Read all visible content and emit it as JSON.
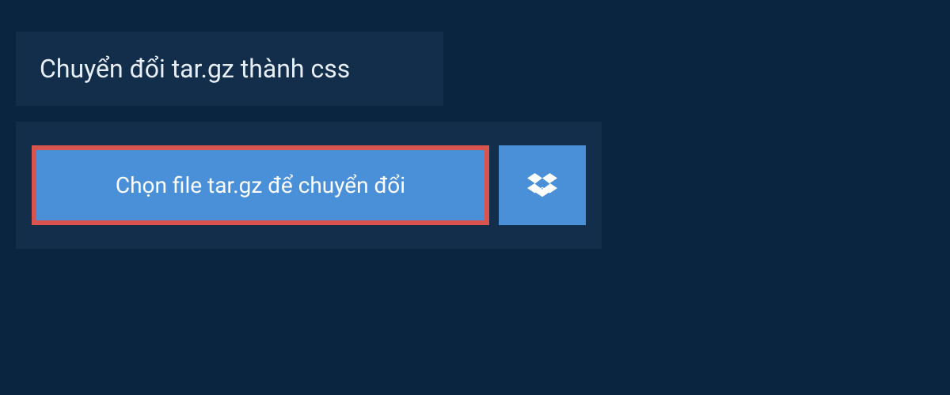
{
  "header": {
    "title": "Chuyển đổi tar.gz thành css"
  },
  "upload": {
    "choose_label": "Chọn file tar.gz để chuyển đổi"
  }
}
